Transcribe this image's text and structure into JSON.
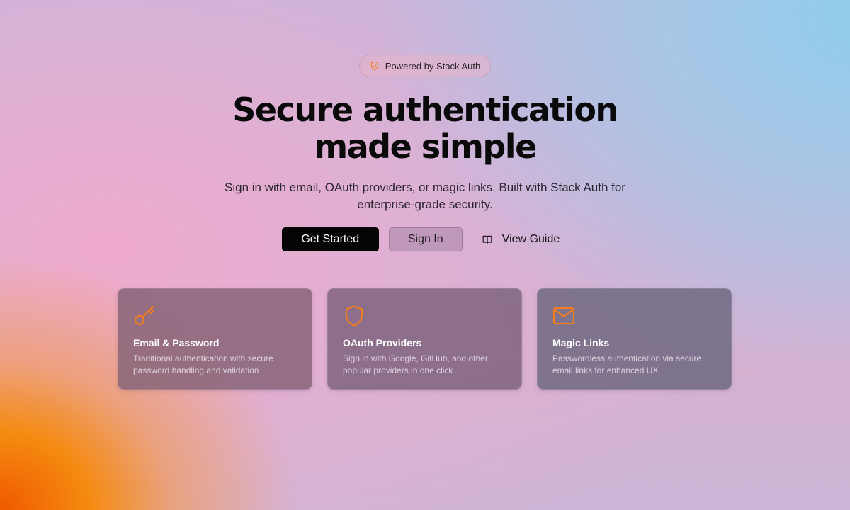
{
  "badge": {
    "icon": "shield-check-icon",
    "label": "Powered by Stack Auth"
  },
  "hero": {
    "title_line1": "Secure authentication",
    "title_line2": "made simple",
    "subtitle": "Sign in with email, OAuth providers, or magic links. Built with Stack Auth for enterprise-grade security."
  },
  "actions": {
    "get_started": "Get Started",
    "sign_in": "Sign In",
    "view_guide": "View Guide",
    "view_guide_icon": "book-icon"
  },
  "features": [
    {
      "icon": "key-icon",
      "title": "Email & Password",
      "description": "Traditional authentication with secure password handling and validation"
    },
    {
      "icon": "shield-icon",
      "title": "OAuth Providers",
      "description": "Sign in with Google, GitHub, and other popular providers in one click"
    },
    {
      "icon": "mail-icon",
      "title": "Magic Links",
      "description": "Passwordless authentication via secure email links for enhanced UX"
    }
  ],
  "colors": {
    "accent": "#f07d1e",
    "primary_button": "#050505"
  }
}
